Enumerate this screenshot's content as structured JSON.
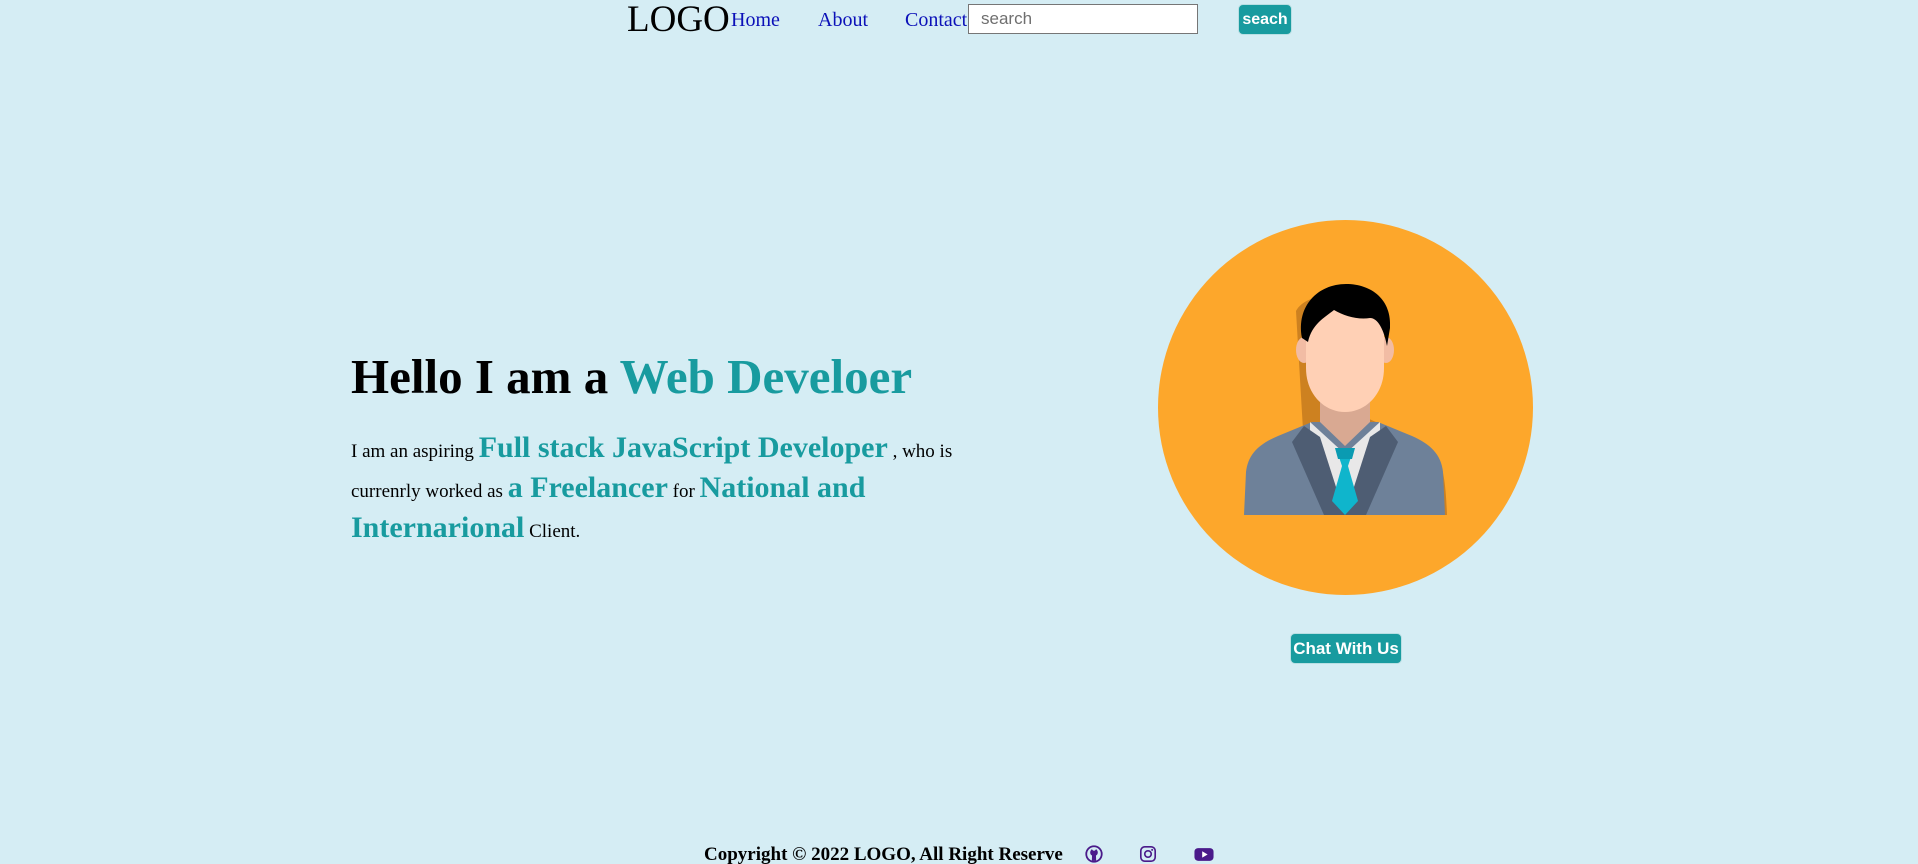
{
  "nav": {
    "logo": "LOGO",
    "links": [
      "Home",
      "About",
      "Contact"
    ],
    "search_placeholder": "search",
    "search_value": "",
    "search_button": "seach"
  },
  "hero": {
    "title_prefix": "Hello I am a ",
    "title_highlight": "Web Develoer",
    "desc": [
      {
        "text": "I am an aspiring ",
        "highlight": false
      },
      {
        "text": "Full stack JavaScript Developer",
        "highlight": true
      },
      {
        "text": " , who is currenrly worked as ",
        "highlight": false
      },
      {
        "text": "a Freelancer",
        "highlight": true
      },
      {
        "text": " for ",
        "highlight": false
      },
      {
        "text": "National and Internarional",
        "highlight": true
      },
      {
        "text": " Client.",
        "highlight": false
      }
    ],
    "chat_button": "Chat With Us"
  },
  "footer": {
    "copyright": "Copyright © 2022 LOGO, All Right Reserve",
    "social_icons": [
      "github-icon",
      "instagram-icon",
      "youtube-icon"
    ]
  },
  "colors": {
    "background": "#d5edf4",
    "accent": "#189b9f",
    "link": "#0b10b8",
    "avatar_circle": "#fda72b",
    "social_icon": "#4a1a8a"
  }
}
